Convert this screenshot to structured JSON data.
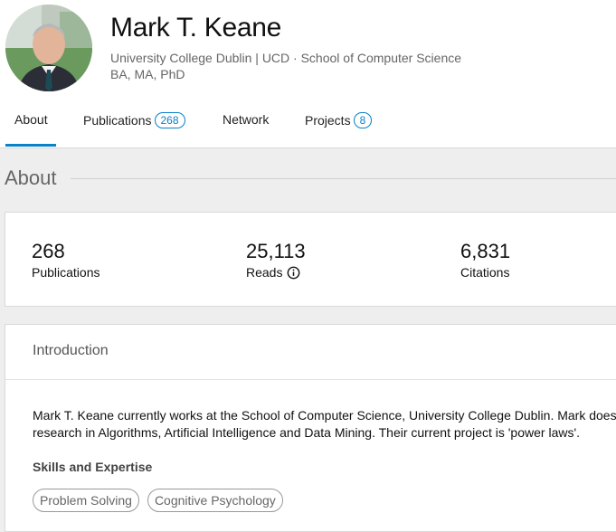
{
  "profile": {
    "name": "Mark T. Keane",
    "affiliation": "University College Dublin | UCD · School of Computer Science",
    "degrees": "BA, MA, PhD"
  },
  "tabs": [
    {
      "label": "About",
      "active": true
    },
    {
      "label": "Publications",
      "count": "268"
    },
    {
      "label": "Network"
    },
    {
      "label": "Projects",
      "count": "8"
    }
  ],
  "section": {
    "title": "About"
  },
  "stats": [
    {
      "value": "268",
      "label": "Publications"
    },
    {
      "value": "25,113",
      "label": "Reads",
      "icon": "info-icon"
    },
    {
      "value": "6,831",
      "label": "Citations"
    }
  ],
  "intro": {
    "title": "Introduction",
    "text_line1": "Mark T. Keane currently works at the School of Computer Science, University College Dublin. Mark does",
    "text_line2": "research in Algorithms, Artificial Intelligence and Data Mining. Their current project is 'power laws'.",
    "skills_title": "Skills and Expertise",
    "skills": [
      "Problem Solving",
      "Cognitive Psychology"
    ]
  },
  "colors": {
    "accent": "#0a82c8",
    "background": "#eeeeee"
  }
}
